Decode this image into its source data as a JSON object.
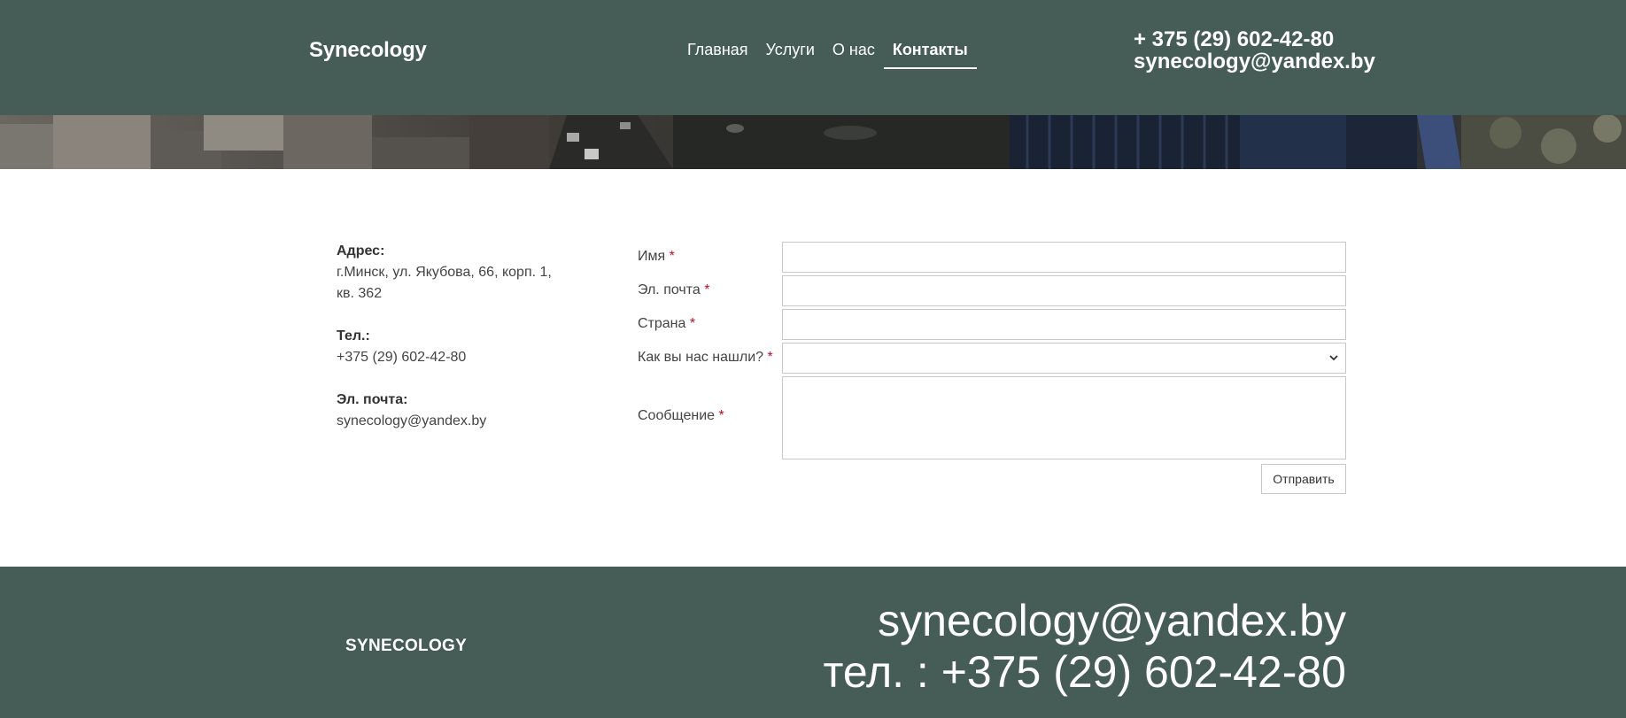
{
  "header": {
    "logo": "Synecology",
    "nav": [
      "Главная",
      "Услуги",
      "О нас",
      "Контакты"
    ],
    "active_nav": "Контакты",
    "phone": "+ 375 (29) 602-42-80",
    "email": "synecology@yandex.by"
  },
  "contact_info": {
    "address_label": "Адрес:",
    "address_line1": "г.Минск, ул. Якубова, 66, корп. 1,",
    "address_line2": "кв. 362",
    "phone_label": "Тел.:",
    "phone": "+375 (29) 602-42-80",
    "email_label": "Эл. почта:",
    "email": "synecology@yandex.by"
  },
  "form": {
    "required_mark": "*",
    "name_label": "Имя",
    "email_label": "Эл. почта",
    "country_label": "Страна",
    "source_label": "Как вы нас нашли?",
    "source_value": "",
    "message_label": "Сообщение",
    "submit_label": "Отправить"
  },
  "footer": {
    "logo": "SYNECOLOGY",
    "email": "synecology@yandex.by",
    "phone": "тел. : +375 (29) 602-42-80"
  },
  "colors": {
    "header_bg": "#455c57",
    "footer_bg": "#455c57",
    "required": "#b3122b"
  }
}
